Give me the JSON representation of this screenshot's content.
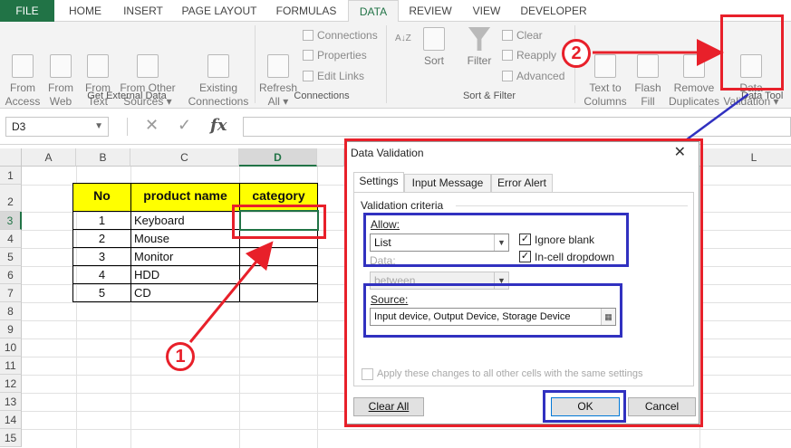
{
  "ribbon": {
    "tabs": [
      {
        "label": "FILE"
      },
      {
        "label": "HOME"
      },
      {
        "label": "INSERT"
      },
      {
        "label": "PAGE LAYOUT"
      },
      {
        "label": "FORMULAS"
      },
      {
        "label": "DATA"
      },
      {
        "label": "REVIEW"
      },
      {
        "label": "VIEW"
      },
      {
        "label": "DEVELOPER"
      }
    ],
    "active_tab": "DATA",
    "get_external": {
      "from_access": "From\nAccess",
      "from_web": "From\nWeb",
      "from_text": "From\nText",
      "from_other": "From Other\nSources ▾",
      "existing": "Existing\nConnections",
      "label": "Get External Data"
    },
    "connections": {
      "refresh": "Refresh\nAll ▾",
      "connections": "Connections",
      "properties": "Properties",
      "edit_links": "Edit Links",
      "label": "Connections"
    },
    "sort_filter": {
      "az": "A↓Z",
      "sort": "Sort",
      "filter": "Filter",
      "clear": "Clear",
      "reapply": "Reapply",
      "advanced": "Advanced",
      "label": "Sort & Filter"
    },
    "data_tools": {
      "text_to_columns": "Text to\nColumns",
      "flash_fill": "Flash\nFill",
      "remove_duplicates": "Remove\nDuplicates",
      "data_validation": "Data\nValidation ▾",
      "label": "Data Tool"
    }
  },
  "formula_bar": {
    "name_box": "D3",
    "fx": "fx"
  },
  "sheet": {
    "columns": [
      "A",
      "B",
      "C",
      "D",
      "L"
    ],
    "rows": [
      "1",
      "2",
      "3",
      "4",
      "5",
      "6",
      "7",
      "8",
      "9",
      "10",
      "11",
      "12",
      "13",
      "14",
      "15"
    ],
    "headers": {
      "no": "No",
      "product": "product name",
      "category": "category"
    },
    "table": [
      {
        "no": "1",
        "product": "Keyboard"
      },
      {
        "no": "2",
        "product": "Mouse"
      },
      {
        "no": "3",
        "product": "Monitor"
      },
      {
        "no": "4",
        "product": "HDD"
      },
      {
        "no": "5",
        "product": "CD"
      }
    ]
  },
  "dialog": {
    "title": "Data Validation",
    "close": "✕",
    "tabs": [
      "Settings",
      "Input Message",
      "Error Alert"
    ],
    "criteria_label": "Validation criteria",
    "allow_label": "Allow:",
    "allow_value": "List",
    "data_label": "Data:",
    "data_value": "between",
    "ignore_blank": "Ignore blank",
    "in_cell_dropdown": "In-cell dropdown",
    "source_label": "Source:",
    "source_value": "Input device, Output Device, Storage Device",
    "apply_all": "Apply these changes to all other cells with the same settings",
    "clear_all": "Clear All",
    "ok": "OK",
    "cancel": "Cancel"
  },
  "annotations": {
    "step1": "1",
    "step2": "2",
    "red": "#e8202a",
    "blue": "#3131c0"
  },
  "colors": {
    "excel_green": "#217346",
    "header_fill": "#ffff00"
  }
}
